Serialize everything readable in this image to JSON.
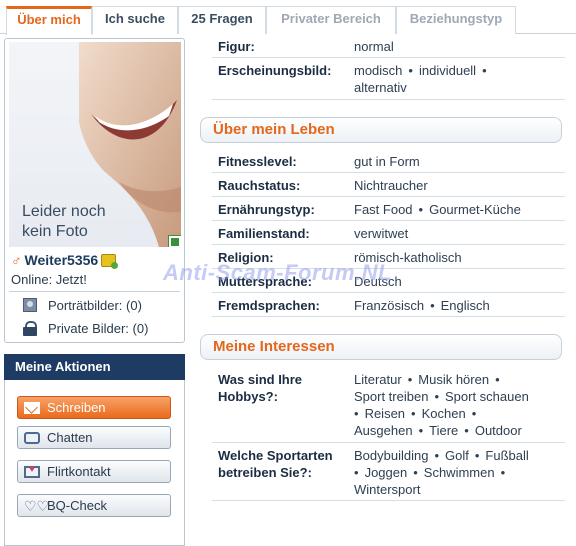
{
  "tabs": [
    {
      "label": "Über mich",
      "state": "active"
    },
    {
      "label": "Ich suche",
      "state": "normal"
    },
    {
      "label": "25 Fragen",
      "state": "normal"
    },
    {
      "label": "Privater Bereich",
      "state": "disabled"
    },
    {
      "label": "Beziehungstyp",
      "state": "disabled"
    }
  ],
  "profile": {
    "photo_caption": "Leider noch kein Foto",
    "gender_symbol": "♂",
    "username": "Weiter5356",
    "online": "Online: Jetzt!",
    "portrait_pics": "Porträtbilder: (0)",
    "private_pics": "Private Bilder: (0)"
  },
  "actions": {
    "title": "Meine Aktionen",
    "buttons": [
      "Schreiben",
      "Chatten",
      "Flirtkontakt",
      "BQ-Check"
    ]
  },
  "top_rows": [
    {
      "label": "Figur:",
      "value": "normal"
    },
    {
      "label": "Erscheinungsbild:",
      "values": [
        "modisch",
        "individuell",
        "alternativ"
      ]
    }
  ],
  "section_leben": {
    "title": "Über mein Leben",
    "rows": [
      {
        "label": "Fitnesslevel:",
        "value": "gut in Form"
      },
      {
        "label": "Rauchstatus:",
        "value": "Nichtraucher"
      },
      {
        "label": "Ernährungstyp:",
        "values": [
          "Fast Food",
          "Gourmet-Küche"
        ]
      },
      {
        "label": "Familienstand:",
        "value": "verwitwet"
      },
      {
        "label": "Religion:",
        "value": "römisch-katholisch"
      },
      {
        "label": "Muttersprache:",
        "value": "Deutsch"
      },
      {
        "label": "Fremdsprachen:",
        "values": [
          "Französisch",
          "Englisch"
        ]
      }
    ]
  },
  "section_interessen": {
    "title": "Meine Interessen",
    "rows": [
      {
        "label": "Was sind Ihre Hobbys?:",
        "values": [
          "Literatur",
          "Musik hören",
          "Sport treiben",
          "Sport schauen",
          "Reisen",
          "Kochen",
          "Ausgehen",
          "Tiere",
          "Outdoor"
        ]
      },
      {
        "label": "Welche Sportarten betreiben Sie?:",
        "values": [
          "Bodybuilding",
          "Golf",
          "Fußball",
          "Joggen",
          "Schwimmen",
          "Wintersport"
        ]
      }
    ]
  },
  "watermark": "Anti-Scam-Forum.NL",
  "colors": {
    "accent": "#e4671c",
    "header_navy": "#1e3c63",
    "label_text": "#1b2d42"
  },
  "icons": [
    "male-symbol-icon",
    "vip-badge-icon",
    "portrait-icon",
    "lock-icon",
    "envelope-icon",
    "chat-bubble-icon",
    "flirt-card-icon",
    "hearts-icon",
    "photo-zoom-icon"
  ]
}
